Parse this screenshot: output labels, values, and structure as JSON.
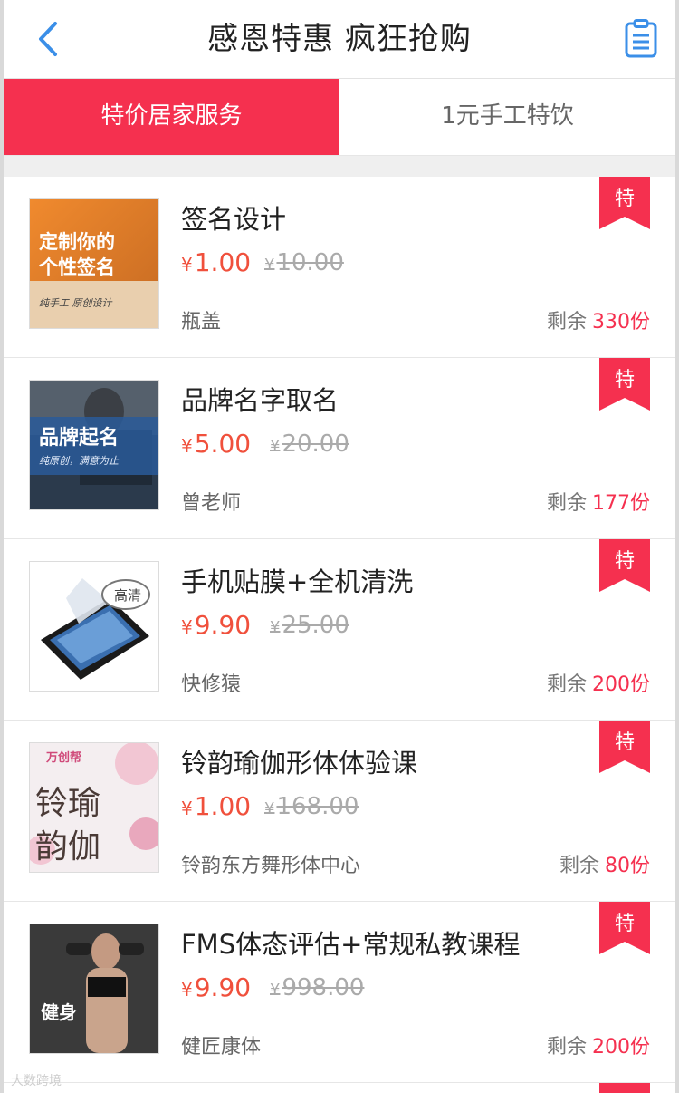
{
  "header": {
    "title": "感恩特惠 疯狂抢购",
    "back_icon": "chevron-left-icon",
    "list_icon": "clipboard-list-icon",
    "accent_color": "#3b8fe8"
  },
  "tabs": [
    {
      "label": "特价居家服务",
      "active": true
    },
    {
      "label": "1元手工特饮",
      "active": false
    }
  ],
  "theme": {
    "brand_color": "#f5304f",
    "price_color": "#f0503c"
  },
  "items": [
    {
      "name": "签名设计",
      "currency": "¥",
      "price": "1.00",
      "original_price": "10.00",
      "seller": "瓶盖",
      "remaining_label": "剩余",
      "remaining_count": "330份",
      "badge": "特",
      "thumb_text": [
        "定制你的",
        "个性签名",
        "纯手工 原创设计"
      ]
    },
    {
      "name": "品牌名字取名",
      "currency": "¥",
      "price": "5.00",
      "original_price": "20.00",
      "seller": "曾老师",
      "remaining_label": "剩余",
      "remaining_count": "177份",
      "badge": "特",
      "thumb_text": [
        "品牌起名",
        "纯原创，满意为止"
      ]
    },
    {
      "name": "手机贴膜+全机清洗",
      "currency": "¥",
      "price": "9.90",
      "original_price": "25.00",
      "seller": "快修猿",
      "remaining_label": "剩余",
      "remaining_count": "200份",
      "badge": "特",
      "thumb_text": [
        "高清"
      ]
    },
    {
      "name": "铃韵瑜伽形体体验课",
      "currency": "¥",
      "price": "1.00",
      "original_price": "168.00",
      "seller": "铃韵东方舞形体中心",
      "remaining_label": "剩余",
      "remaining_count": "80份",
      "badge": "特",
      "thumb_text": [
        "万创帮",
        "铃瑜",
        "韵伽"
      ]
    },
    {
      "name": "FMS体态评估+常规私教课程",
      "currency": "¥",
      "price": "9.90",
      "original_price": "998.00",
      "seller": "健匠康体",
      "remaining_label": "剩余",
      "remaining_count": "200份",
      "badge": "特",
      "thumb_text": [
        "健身"
      ]
    }
  ],
  "watermark": "大数跨境"
}
